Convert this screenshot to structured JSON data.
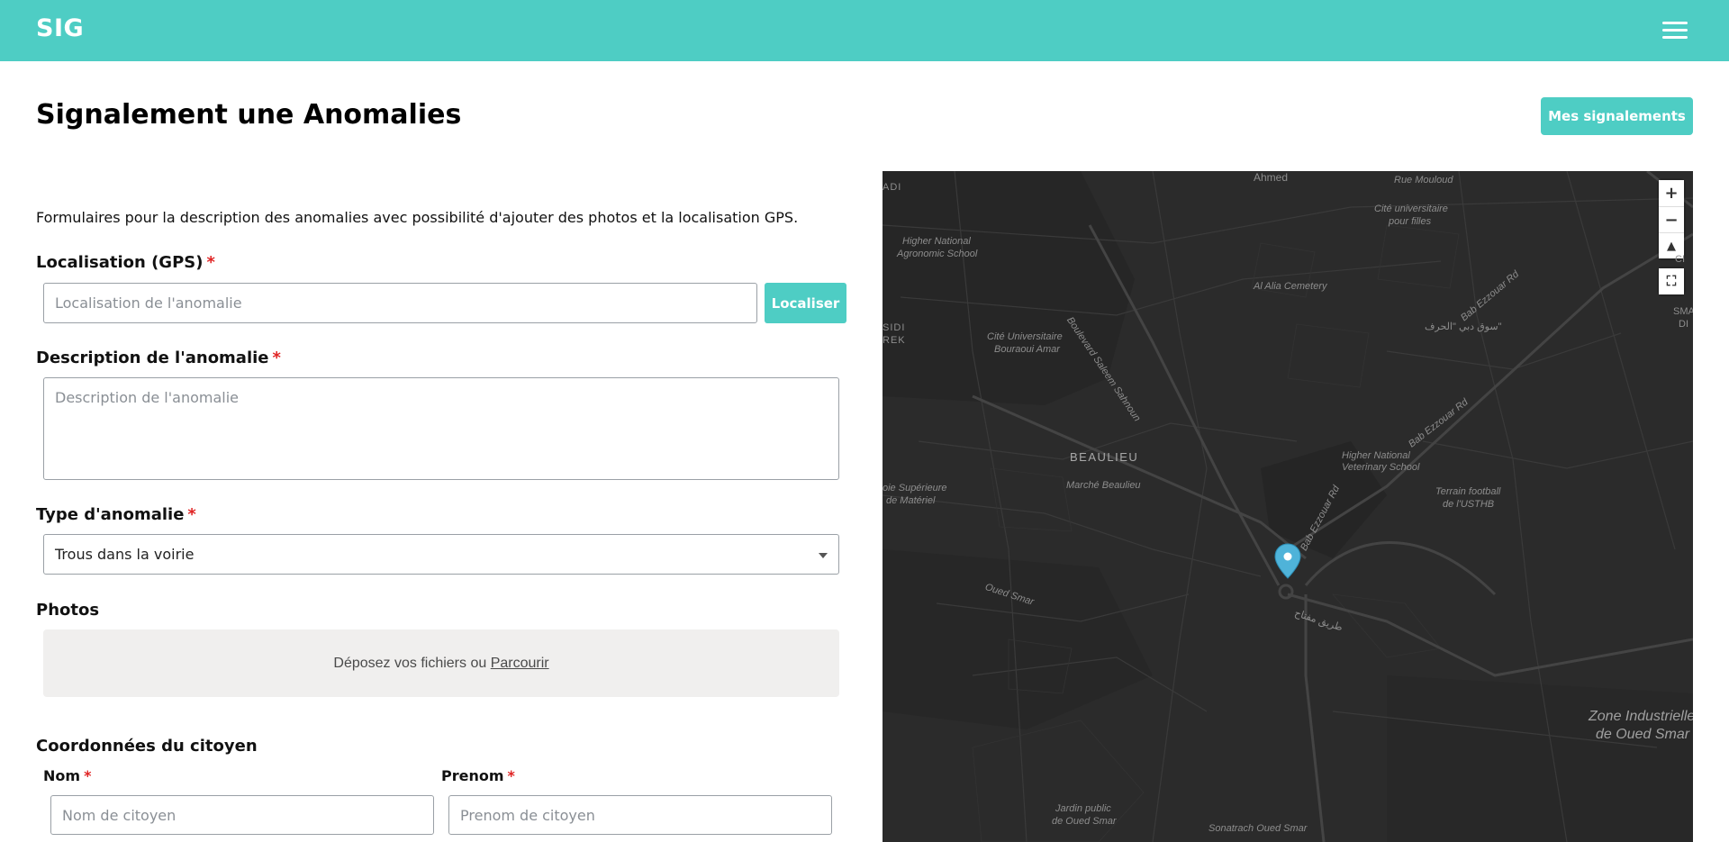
{
  "header": {
    "brand": "SIG",
    "menu_icon": "hamburger-icon",
    "accent_color": "#4ecdc4"
  },
  "page": {
    "title": "Signalement une Anomalies",
    "my_reports_label": "Mes signalements"
  },
  "form": {
    "intro": "Formulaires pour la description des anomalies avec possibilité d'ajouter des photos et la localisation GPS.",
    "required_mark": "*",
    "location": {
      "label": "Localisation (GPS)",
      "placeholder": "Localisation de l'anomalie",
      "value": "",
      "button": "Localiser"
    },
    "description": {
      "label": "Description de l'anomalie",
      "placeholder": "Description de l'anomalie",
      "value": ""
    },
    "type": {
      "label": "Type d'anomalie",
      "selected": "Trous dans la voirie"
    },
    "photos": {
      "label": "Photos",
      "dropzone_text": "Déposez vos fichiers ou",
      "browse_link": "Parcourir"
    },
    "citizen": {
      "section_title": "Coordonnées du citoyen",
      "nom": {
        "label": "Nom",
        "placeholder": "Nom de citoyen"
      },
      "prenom": {
        "label": "Prenom",
        "placeholder": "Prenom de citoyen"
      }
    }
  },
  "map": {
    "controls": {
      "zoom_in": "+",
      "zoom_out": "−",
      "compass": "compass-icon",
      "fullscreen": "fullscreen-icon"
    },
    "marker": "map-pin-icon",
    "marker_color": "#4fb3d9",
    "labels": [
      "Ahmed",
      "ADI",
      "Rue Mouloud",
      "Cité universitaire",
      "pour filles",
      "Higher National",
      "Agronomic School",
      "Boulevard Saleem Sahnoun",
      "Al Alia Cemetery",
      "سوق دبي \"الحرف\"",
      "SIDI",
      "REK",
      "Cité Universitaire",
      "Bouraoui Amar",
      "SMAI",
      "DI",
      "CI",
      "Bab Ezzouar Rd",
      "BEAULIEU",
      "Marché Beaulieu",
      "Higher National",
      "Veterinary School",
      "Terrain football",
      "de l'USTHB",
      "oie Supérieure",
      "de Matériel",
      "Oued Smar",
      "طريق مفتاح",
      "Zone Industrielle",
      "de Oued Smar",
      "Jardin public",
      "de Oued Smar",
      "Sonatrach Oued Smar"
    ]
  }
}
